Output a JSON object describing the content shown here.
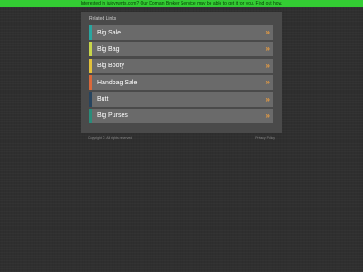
{
  "banner": {
    "text": "Interested in juicyrwnts.com? Our Domain Broker Service may be able to get it for you. Find out how."
  },
  "panel": {
    "title": "Related Links",
    "links": [
      {
        "label": "Big Sale",
        "accent": "#29a6a0",
        "icon": "double-chevron-right-icon",
        "chevron": "»"
      },
      {
        "label": "Big Bag",
        "accent": "#c8d64a",
        "icon": "double-chevron-right-icon",
        "chevron": "»"
      },
      {
        "label": "Big Booty",
        "accent": "#e2c13a",
        "icon": "double-chevron-right-icon",
        "chevron": "»"
      },
      {
        "label": "Handbag Sale",
        "accent": "#d9683a",
        "icon": "double-chevron-right-icon",
        "chevron": "»"
      },
      {
        "label": "Butt",
        "accent": "#27445e",
        "icon": "double-chevron-right-icon",
        "chevron": "»"
      },
      {
        "label": "Big Purses",
        "accent": "#2a8c7a",
        "icon": "double-chevron-right-icon",
        "chevron": "»"
      }
    ]
  },
  "footer": {
    "copyright": "Copyright ©. All rights reserved.",
    "privacy": "Privacy Policy"
  },
  "colors": {
    "banner_bg": "#33cc33",
    "chevron": "#f0a040"
  }
}
